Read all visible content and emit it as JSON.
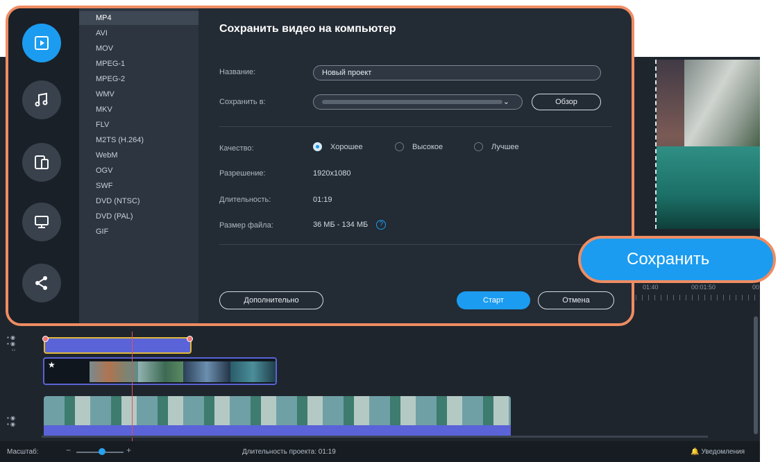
{
  "dialog": {
    "title": "Сохранить видео на компьютер",
    "name_label": "Название:",
    "name_value": "Новый проект",
    "save_to_label": "Сохранить в:",
    "save_to_value": "                                            ",
    "browse_label": "Обзор",
    "quality_label": "Качество:",
    "quality_options": [
      "Хорошее",
      "Высокое",
      "Лучшее"
    ],
    "quality_selected": "Хорошее",
    "resolution_label": "Разрешение:",
    "resolution_value": "1920x1080",
    "duration_label": "Длительность:",
    "duration_value": "01:19",
    "filesize_label": "Размер файла:",
    "filesize_value": "36 МБ - 134 МБ",
    "help_glyph": "?",
    "advanced_label": "Дополнительно",
    "start_label": "Старт",
    "cancel_label": "Отмена",
    "chevron": "⌄"
  },
  "categories": [
    "video-file-icon",
    "music-note-icon",
    "devices-icon",
    "monitor-icon",
    "share-icon"
  ],
  "formats": [
    "MP4",
    "AVI",
    "MOV",
    "MPEG-1",
    "MPEG-2",
    "WMV",
    "MKV",
    "FLV",
    "M2TS (H.264)",
    "WebM",
    "OGV",
    "SWF",
    "DVD (NTSC)",
    "DVD (PAL)",
    "GIF"
  ],
  "selected_format": "MP4",
  "save_button_label": "Сохранить",
  "ruler": [
    "01:40",
    "00:01:50",
    "00"
  ],
  "status": {
    "scale_label": "Масштаб:",
    "minus": "−",
    "plus": "+",
    "project_duration": "Длительность проекта: 01:19",
    "notifications": "Уведомления",
    "bell": "🔔"
  },
  "colors": {
    "accent": "#1b9cf0",
    "highlight": "#ef8c62",
    "clip": "#5b63d8"
  }
}
